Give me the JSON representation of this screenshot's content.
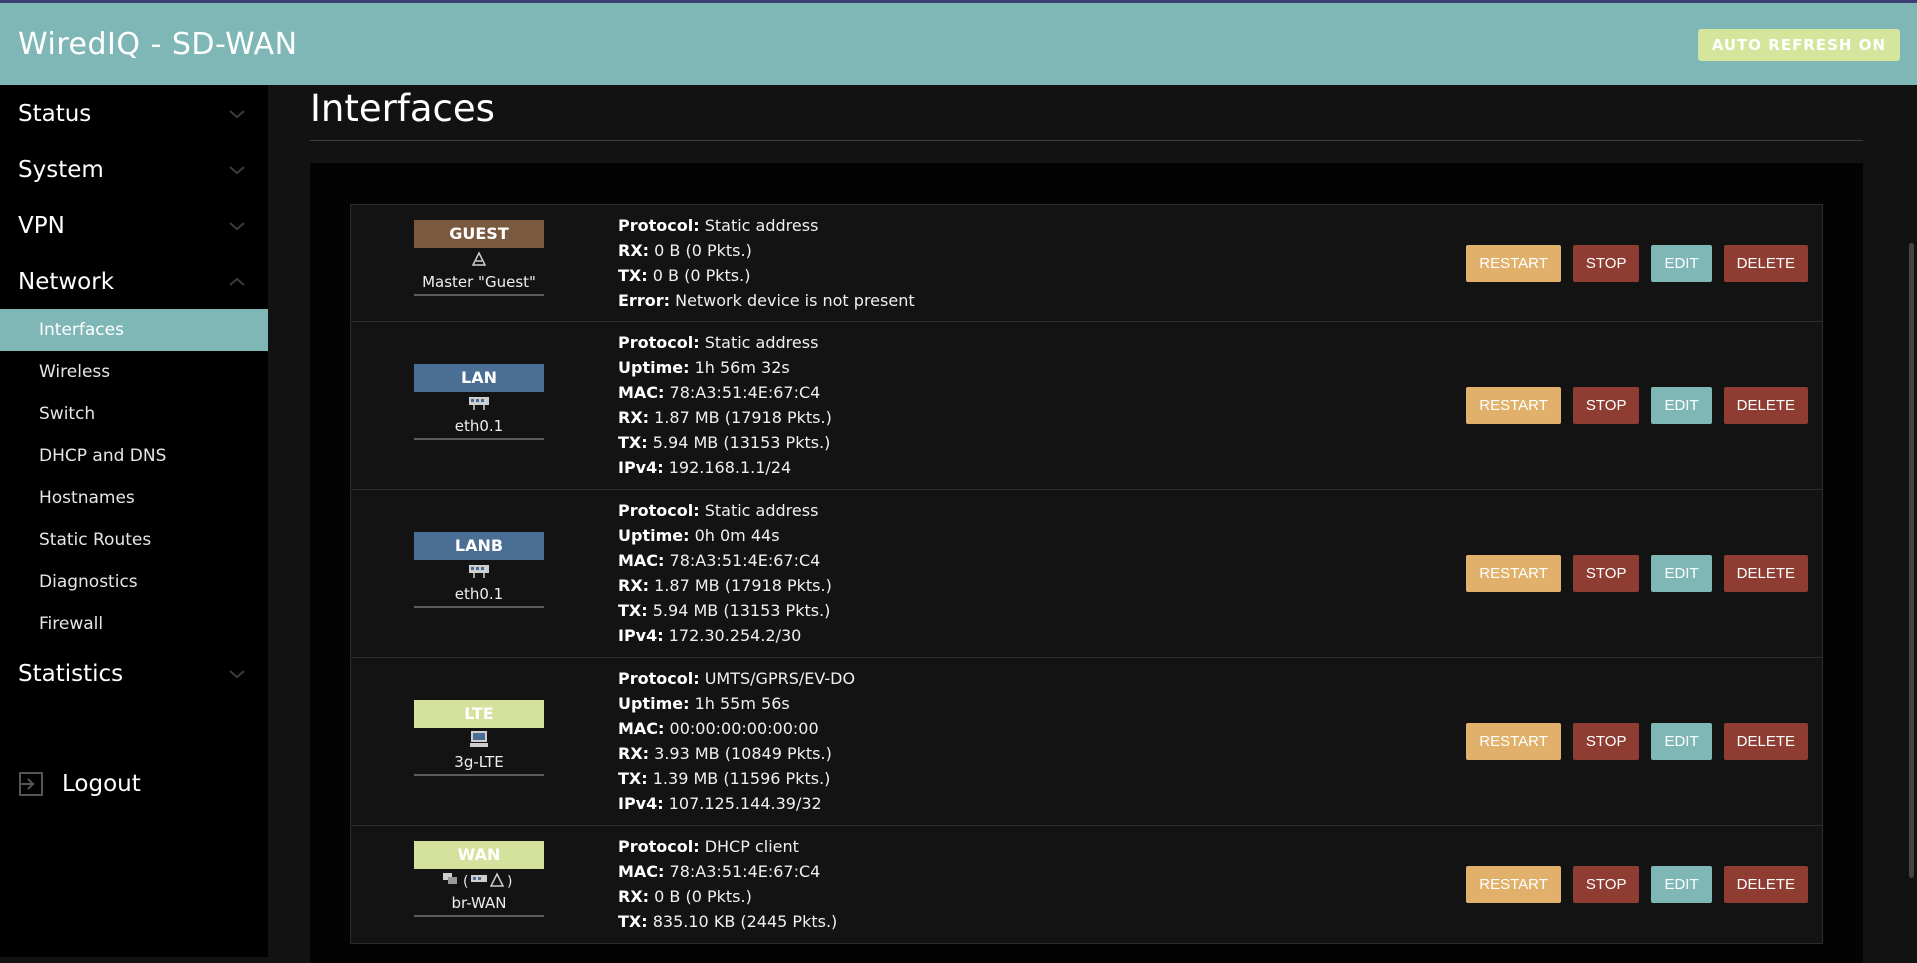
{
  "header": {
    "brand": "WiredIQ  -  SD-WAN",
    "auto_refresh": "AUTO REFRESH ON"
  },
  "sidebar": {
    "groups": [
      {
        "label": "Status"
      },
      {
        "label": "System"
      },
      {
        "label": "VPN"
      },
      {
        "label": "Network"
      },
      {
        "label": "Statistics"
      }
    ],
    "network_items": [
      {
        "label": "Interfaces"
      },
      {
        "label": "Wireless"
      },
      {
        "label": "Switch"
      },
      {
        "label": "DHCP and DNS"
      },
      {
        "label": "Hostnames"
      },
      {
        "label": "Static Routes"
      },
      {
        "label": "Diagnostics"
      },
      {
        "label": "Firewall"
      }
    ],
    "logout": "Logout"
  },
  "page": {
    "title": "Interfaces"
  },
  "actions": {
    "restart": "RESTART",
    "stop": "STOP",
    "edit": "EDIT",
    "delete": "DELETE"
  },
  "interfaces": [
    {
      "name": "GUEST",
      "color": "#7a5a3e",
      "device": "Master \"Guest\"",
      "icon": "wireless-icon",
      "fields": [
        {
          "key": "Protocol:",
          "value": "Static address"
        },
        {
          "key": "RX:",
          "value": "0 B (0 Pkts.)"
        },
        {
          "key": "TX:",
          "value": "0 B (0 Pkts.)"
        },
        {
          "key": "Error:",
          "value": "Network device is not present"
        }
      ]
    },
    {
      "name": "LAN",
      "color": "#4b6e95",
      "device": "eth0.1",
      "icon": "switch-icon",
      "fields": [
        {
          "key": "Protocol:",
          "value": "Static address"
        },
        {
          "key": "Uptime:",
          "value": "1h 56m 32s"
        },
        {
          "key": "MAC:",
          "value": "78:A3:51:4E:67:C4"
        },
        {
          "key": "RX:",
          "value": "1.87 MB (17918 Pkts.)"
        },
        {
          "key": "TX:",
          "value": "5.94 MB (13153 Pkts.)"
        },
        {
          "key": "IPv4:",
          "value": "192.168.1.1/24"
        }
      ]
    },
    {
      "name": "LANB",
      "color": "#4b6e95",
      "device": "eth0.1",
      "icon": "switch-icon",
      "fields": [
        {
          "key": "Protocol:",
          "value": "Static address"
        },
        {
          "key": "Uptime:",
          "value": "0h 0m 44s"
        },
        {
          "key": "MAC:",
          "value": "78:A3:51:4E:67:C4"
        },
        {
          "key": "RX:",
          "value": "1.87 MB (17918 Pkts.)"
        },
        {
          "key": "TX:",
          "value": "5.94 MB (13153 Pkts.)"
        },
        {
          "key": "IPv4:",
          "value": "172.30.254.2/30"
        }
      ]
    },
    {
      "name": "LTE",
      "color": "#d4e29e",
      "device": "3g-LTE",
      "icon": "modem-icon",
      "fields": [
        {
          "key": "Protocol:",
          "value": "UMTS/GPRS/EV-DO"
        },
        {
          "key": "Uptime:",
          "value": "1h 55m 56s"
        },
        {
          "key": "MAC:",
          "value": "00:00:00:00:00:00"
        },
        {
          "key": "RX:",
          "value": "3.93 MB (10849 Pkts.)"
        },
        {
          "key": "TX:",
          "value": "1.39 MB (11596 Pkts.)"
        },
        {
          "key": "IPv4:",
          "value": "107.125.144.39/32"
        }
      ]
    },
    {
      "name": "WAN",
      "color": "#d4e29e",
      "device": "br-WAN",
      "icon": "bridge-icon",
      "fields": [
        {
          "key": "Protocol:",
          "value": "DHCP client"
        },
        {
          "key": "MAC:",
          "value": "78:A3:51:4E:67:C4"
        },
        {
          "key": "RX:",
          "value": "0 B (0 Pkts.)"
        },
        {
          "key": "TX:",
          "value": "835.10 KB (2445 Pkts.)"
        }
      ]
    }
  ]
}
